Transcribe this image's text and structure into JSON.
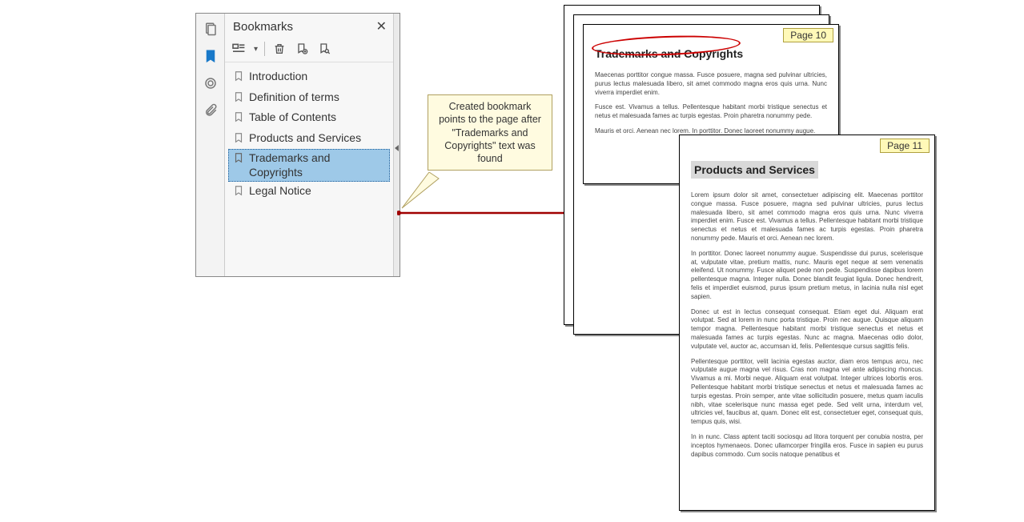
{
  "panel": {
    "title": "Bookmarks",
    "items": [
      {
        "label": "Introduction"
      },
      {
        "label": "Definition of terms"
      },
      {
        "label": "Table of Contents"
      },
      {
        "label": "Products and Services"
      },
      {
        "label": "Trademarks and Copyrights",
        "selected": true
      },
      {
        "label": "Legal Notice"
      }
    ]
  },
  "callout": {
    "text": "Created bookmark points to the page after \"Trademarks and Copyrights\" text was found"
  },
  "pages": {
    "p10": {
      "label": "Page 10",
      "title": "Trademarks and Copyrights",
      "para1": "Maecenas porttitor congue massa. Fusce posuere, magna sed pulvinar ultricies, purus lectus malesuada libero, sit amet commodo magna eros quis urna. Nunc viverra imperdiet enim.",
      "para2": "Fusce est. Vivamus a tellus. Pellentesque habitant morbi tristique senectus et netus et malesuada fames ac turpis egestas. Proin pharetra nonummy pede.",
      "para3": "Mauris et orci. Aenean nec lorem. In porttitor. Donec laoreet nonummy augue."
    },
    "p11": {
      "label": "Page 11",
      "title": "Products and Services",
      "para1": "Lorem ipsum dolor sit amet, consectetuer adipiscing elit. Maecenas porttitor congue massa. Fusce posuere, magna sed pulvinar ultricies, purus lectus malesuada libero, sit amet commodo magna eros quis urna. Nunc viverra imperdiet enim. Fusce est. Vivamus a tellus. Pellentesque habitant morbi tristique senectus et netus et malesuada fames ac turpis egestas. Proin pharetra nonummy pede. Mauris et orci. Aenean nec lorem.",
      "para2": "In porttitor. Donec laoreet nonummy augue. Suspendisse dui purus, scelerisque at, vulputate vitae, pretium mattis, nunc. Mauris eget neque at sem venenatis eleifend. Ut nonummy. Fusce aliquet pede non pede. Suspendisse dapibus lorem pellentesque magna. Integer nulla. Donec blandit feugiat ligula. Donec hendrerit, felis et imperdiet euismod, purus ipsum pretium metus, in lacinia nulla nisl eget sapien.",
      "para3": "Donec ut est in lectus consequat consequat. Etiam eget dui. Aliquam erat volutpat. Sed at lorem in nunc porta tristique. Proin nec augue. Quisque aliquam tempor magna. Pellentesque habitant morbi tristique senectus et netus et malesuada fames ac turpis egestas. Nunc ac magna. Maecenas odio dolor, vulputate vel, auctor ac, accumsan id, felis. Pellentesque cursus sagittis felis.",
      "para4": "Pellentesque porttitor, velit lacinia egestas auctor, diam eros tempus arcu, nec vulputate augue magna vel risus. Cras non magna vel ante adipiscing rhoncus. Vivamus a mi. Morbi neque. Aliquam erat volutpat. Integer ultrices lobortis eros. Pellentesque habitant morbi tristique senectus et netus et malesuada fames ac turpis egestas. Proin semper, ante vitae sollicitudin posuere, metus quam iaculis nibh, vitae scelerisque nunc massa eget pede. Sed velit urna, interdum vel, ultricies vel, faucibus at, quam. Donec elit est, consectetuer eget, consequat quis, tempus quis, wisi.",
      "para5": "In in nunc. Class aptent taciti sociosqu ad litora torquent per conubia nostra, per inceptos hymenaeos. Donec ullamcorper fringilla eros. Fusce in sapien eu purus dapibus commodo. Cum sociis natoque penatibus et"
    }
  }
}
